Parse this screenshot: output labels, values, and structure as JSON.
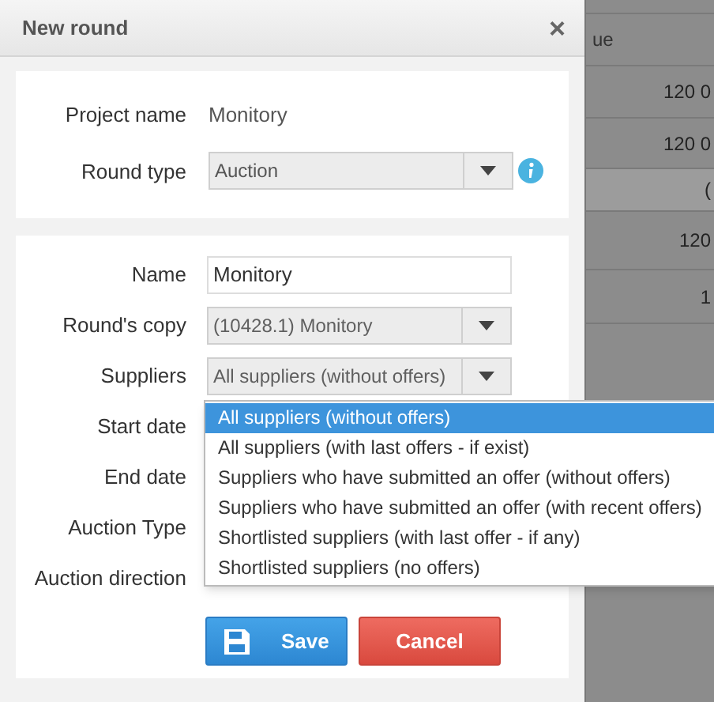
{
  "dialog": {
    "title": "New round",
    "close": "×"
  },
  "project_section": {
    "project_name": {
      "label": "Project name",
      "value": "Monitory"
    },
    "round_type": {
      "label": "Round type",
      "value": "Auction"
    }
  },
  "form": {
    "fields": [
      {
        "kind": "text",
        "label": "Name",
        "value": "Monitory"
      },
      {
        "kind": "select",
        "label": "Round's copy",
        "value": "(10428.1) Monitory"
      },
      {
        "kind": "select",
        "label": "Suppliers",
        "value": "All suppliers (without offers)"
      },
      {
        "kind": "hidden",
        "label": "Start date"
      },
      {
        "kind": "hidden",
        "label": "End date"
      },
      {
        "kind": "hidden",
        "label": "Auction Type"
      },
      {
        "kind": "hidden",
        "label": "Auction direction"
      }
    ],
    "buttons": [
      {
        "kind": "primary",
        "label": "Save"
      },
      {
        "kind": "danger",
        "label": "Cancel"
      }
    ]
  },
  "dropdown": {
    "options": [
      {
        "label": "All suppliers (without offers)",
        "selected": true
      },
      {
        "label": "All suppliers (with last offers - if exist)",
        "selected": false
      },
      {
        "label": "Suppliers who have submitted an offer (without offers)",
        "selected": false
      },
      {
        "label": "Suppliers who have submitted an offer (with recent offers)",
        "selected": false
      },
      {
        "label": "Shortlisted suppliers (with last offer - if any)",
        "selected": false
      },
      {
        "label": "Shortlisted suppliers (no offers)",
        "selected": false
      }
    ]
  },
  "background_table": {
    "header": "ue",
    "cells": [
      "120 0",
      "120 0",
      "(",
      "120",
      "1"
    ]
  }
}
